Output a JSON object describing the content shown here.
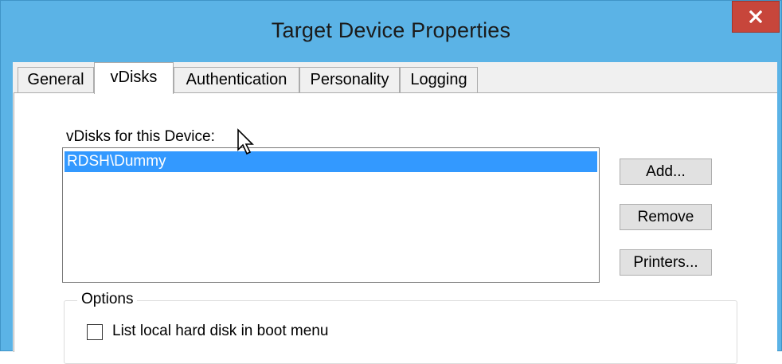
{
  "window": {
    "title": "Target Device Properties",
    "close_label": "x"
  },
  "tabs": [
    {
      "label": "General",
      "active": false
    },
    {
      "label": "vDisks",
      "active": true
    },
    {
      "label": "Authentication",
      "active": false
    },
    {
      "label": "Personality",
      "active": false
    },
    {
      "label": "Logging",
      "active": false
    }
  ],
  "vdisks": {
    "list_label": "vDisks for this Device:",
    "items": [
      {
        "label": "RDSH\\Dummy",
        "selected": true
      }
    ]
  },
  "buttons": {
    "add": "Add...",
    "remove": "Remove",
    "printers": "Printers..."
  },
  "options": {
    "legend": "Options",
    "checkbox_label": "List local hard disk in boot menu",
    "checked": false
  },
  "colors": {
    "titlebar": "#5bb3e6",
    "close_button": "#c7463b",
    "selection": "#3399ff"
  }
}
